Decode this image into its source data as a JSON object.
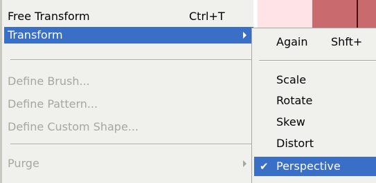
{
  "menu": {
    "items": [
      {
        "label": "Free Transform",
        "shortcut": "Ctrl+T"
      },
      {
        "label": "Transform"
      },
      {
        "label": "Define Brush..."
      },
      {
        "label": "Define Pattern..."
      },
      {
        "label": "Define Custom Shape..."
      },
      {
        "label": "Purge"
      }
    ]
  },
  "submenu": {
    "items": [
      {
        "label": "Again",
        "shortcut": "Shft+"
      },
      {
        "label": "Scale"
      },
      {
        "label": "Rotate"
      },
      {
        "label": "Skew"
      },
      {
        "label": "Distort"
      },
      {
        "label": "Perspective",
        "checked_icon": "✔"
      }
    ]
  },
  "colors": {
    "highlight": "#3a6fc8",
    "menu_bg": "#f0f0ec",
    "disabled_text": "#a7a7a0",
    "canvas_pink": "#ffe3e6",
    "canvas_red": "#c86a6e"
  }
}
